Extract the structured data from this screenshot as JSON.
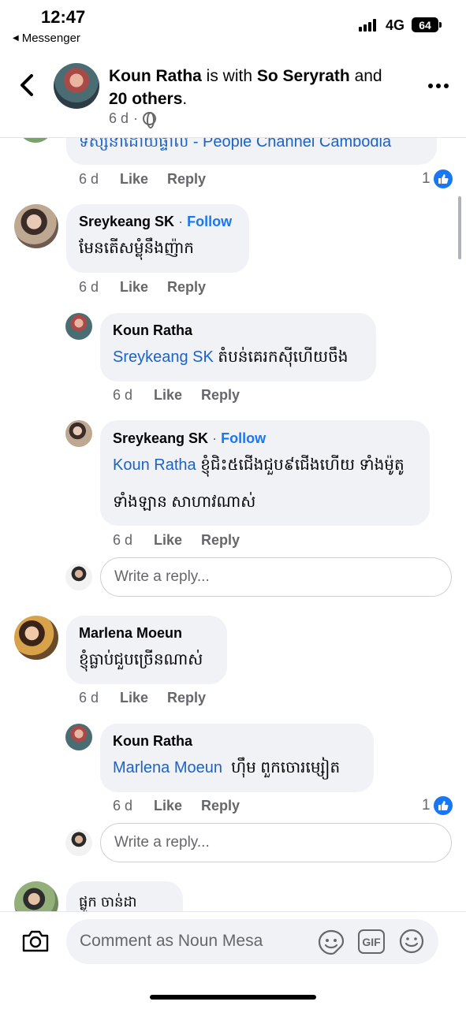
{
  "status_bar": {
    "time": "12:47",
    "back_app": "Messenger",
    "network": "4G",
    "battery": "64"
  },
  "header": {
    "author": "Koun Ratha",
    "connector": " is with ",
    "tagged": "So Seryrath",
    "and": " and ",
    "others": "20 others",
    "period": ".",
    "time": "6 d",
    "separator": "·"
  },
  "top_comment": {
    "text": "ទស្សនាដោយផ្ទាល់ - People Channel Cambodia",
    "time": "6 d",
    "like": "Like",
    "reply": "Reply",
    "reactions": "1"
  },
  "comments": [
    {
      "name": "Sreykeang SK",
      "follow": "Follow",
      "text": "មែនតើសម្លុំនឹងញ៉ាក",
      "time": "6 d",
      "like": "Like",
      "reply": "Reply"
    },
    {
      "name": "Koun Ratha",
      "mention": "Sreykeang SK",
      "text": " តំបន់គេរកស៊ីហើយចឹង",
      "time": "6 d",
      "like": "Like",
      "reply": "Reply"
    },
    {
      "name": "Sreykeang SK",
      "follow": "Follow",
      "mention": "Koun Ratha",
      "text": " ខ្ញុំជិះ៥ជើងជួប៩ជើងហើយ ទាំងម៉ូតូ",
      "text2": "ទាំងឡាន សាហាវណាស់",
      "time": "6 d",
      "like": "Like",
      "reply": "Reply"
    },
    {
      "name": "Marlena Moeun",
      "text": "ខ្ញុំធ្លាប់ជួបច្រើនណាស់",
      "time": "6 d",
      "like": "Like",
      "reply": "Reply"
    },
    {
      "name": "Koun Ratha",
      "mention": "Marlena Moeun",
      "text": "  ហ៊ឹម ពួកចោរម្សៀត",
      "time": "6 d",
      "like": "Like",
      "reply": "Reply",
      "reactions": "1"
    },
    {
      "name": "ផ្លូក ចាន់ដា"
    }
  ],
  "reply_placeholder": "Write a reply...",
  "composer": {
    "placeholder": "Comment as Noun Mesa",
    "gif": "GIF"
  },
  "colors": {
    "link": "#1c63c9",
    "brand": "#1877f2",
    "bubble": "#f0f2f5",
    "muted": "#65676b"
  }
}
